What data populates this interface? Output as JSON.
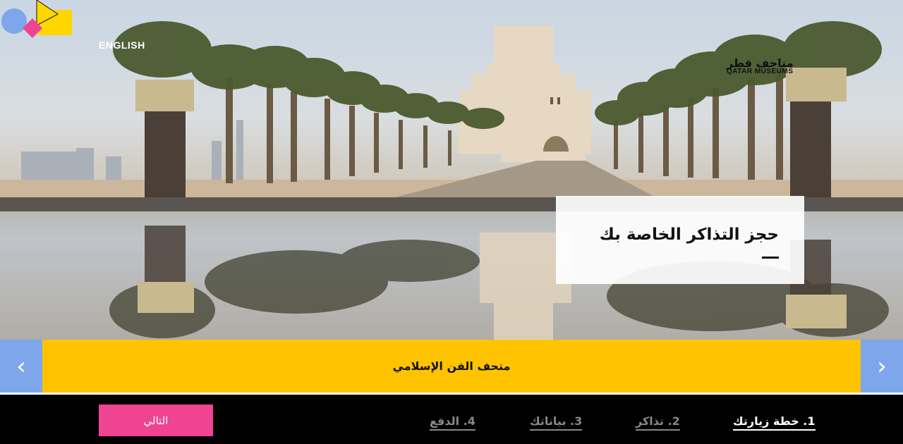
{
  "header": {
    "language_link": "ENGLISH",
    "logo_arabic": "متاحف قطر",
    "logo_english": "QATAR MUSEUMS"
  },
  "hero": {
    "title": "حجز التذاكر الخاصة بك"
  },
  "banner": {
    "museum_name": "متحف الفن الإسلامي",
    "prev_icon": "chevron-left-icon",
    "next_icon": "chevron-right-icon"
  },
  "footer": {
    "next_button": "التالي",
    "steps": [
      {
        "label": "1. خطة زيارتك",
        "active": true
      },
      {
        "label": "2. تذاكر",
        "active": false
      },
      {
        "label": "3. بياناتك",
        "active": false
      },
      {
        "label": "4. الدفع",
        "active": false
      }
    ]
  },
  "colors": {
    "banner": "#ffc300",
    "arrow_buttons": "#7ea6ea",
    "next_button": "#ee4491",
    "logo_blue": "#7ea6ea",
    "logo_pink": "#ee4491",
    "logo_yellow": "#ffd600"
  }
}
